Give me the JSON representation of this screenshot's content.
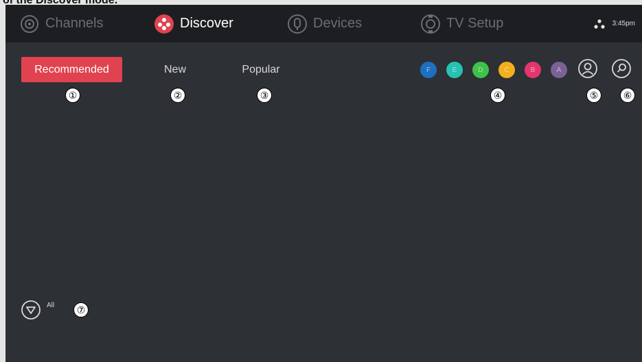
{
  "caption": "of the Discover mode.",
  "nav": {
    "items": [
      {
        "label": "Channels",
        "icon": "channels-icon"
      },
      {
        "label": "Discover",
        "icon": "discover-icon"
      },
      {
        "label": "Devices",
        "icon": "devices-icon"
      },
      {
        "label": "TV Setup",
        "icon": "tv-setup-icon"
      }
    ],
    "active": "Discover",
    "status": {
      "network_icon": "network-icon",
      "time": "3:45pm"
    }
  },
  "tabs": [
    {
      "label": "Recommended",
      "active": true
    },
    {
      "label": "New",
      "active": false
    },
    {
      "label": "Popular",
      "active": false
    }
  ],
  "profiles": [
    {
      "letter": "F",
      "color": "#1e6fc0"
    },
    {
      "letter": "E",
      "color": "#27c2b4"
    },
    {
      "letter": "D",
      "color": "#3ec24a"
    },
    {
      "letter": "C",
      "color": "#f2b01e"
    },
    {
      "letter": "B",
      "color": "#e4356f"
    },
    {
      "letter": "A",
      "color": "#7b6196"
    }
  ],
  "buttons": {
    "user_icon": "user-icon",
    "search_icon": "search-icon"
  },
  "filter": {
    "label": "All",
    "icon": "filter-icon"
  },
  "markers": [
    "①",
    "②",
    "③",
    "④",
    "⑤",
    "⑥",
    "⑦"
  ],
  "colors": {
    "accent": "#e0434f",
    "background": "#2d3035",
    "topbar": "#1c1e22"
  }
}
